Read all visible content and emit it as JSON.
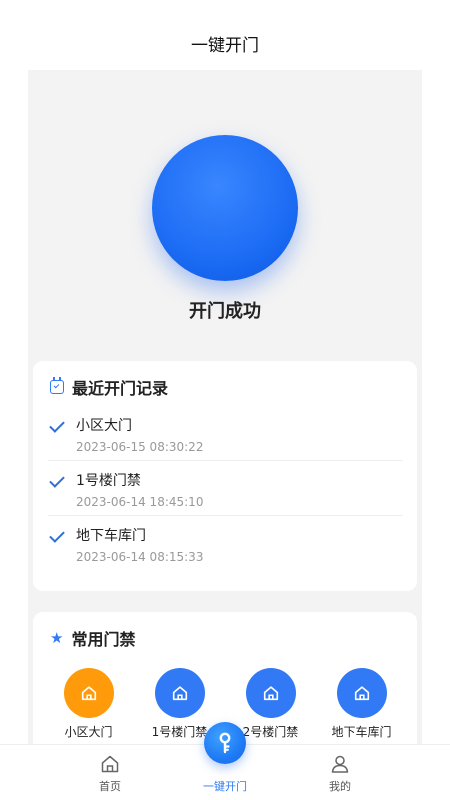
{
  "header": {
    "title": "一键开门"
  },
  "unlock": {
    "status": "开门成功"
  },
  "records": {
    "title": "最近开门记录",
    "items": [
      {
        "name": "小区大门",
        "time": "2023-06-15 08:30:22"
      },
      {
        "name": "1号楼门禁",
        "time": "2023-06-14 18:45:10"
      },
      {
        "name": "地下车库门",
        "time": "2023-06-14 08:15:33"
      }
    ]
  },
  "doors": {
    "title": "常用门禁",
    "items": [
      {
        "label": "小区大门",
        "color": "#ff9a0a"
      },
      {
        "label": "1号楼门禁",
        "color": "#3279f5"
      },
      {
        "label": "2号楼门禁",
        "color": "#3279f5"
      },
      {
        "label": "地下车库门",
        "color": "#3279f5"
      }
    ]
  },
  "tabbar": {
    "home": "首页",
    "unlock": "一键开门",
    "mine": "我的"
  },
  "colors": {
    "accent": "#2f7bf5",
    "orange": "#ff9a0a"
  },
  "icons": {
    "records": "clock-icon",
    "doors": "star-icon",
    "door": "house-icon",
    "home": "home-icon",
    "unlock": "key-icon",
    "mine": "user-icon"
  }
}
